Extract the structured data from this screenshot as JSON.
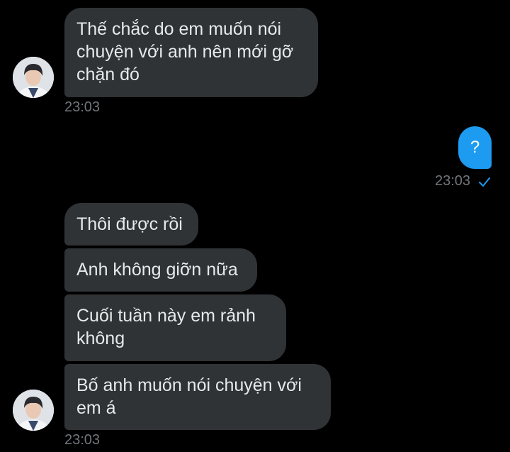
{
  "conversation": {
    "block1": {
      "message": "Thế chắc do em muốn nói\nchuyện với anh nên mới gỡ\nchặn đó",
      "time": "23:03"
    },
    "sent": {
      "message": "?",
      "time": "23:03",
      "status_icon": "checkmark-icon"
    },
    "block2": {
      "messages": [
        "Thôi được rồi",
        "Anh không giỡn nữa",
        "Cuối tuần này em rảnh\nkhông",
        "Bố anh muốn nói chuyện với\nem á"
      ],
      "time": "23:03"
    }
  },
  "colors": {
    "background": "#000000",
    "incoming_bubble": "#2f3336",
    "outgoing_bubble": "#1d9bf0",
    "timestamp": "#71767b",
    "check": "#1d9bf0"
  }
}
